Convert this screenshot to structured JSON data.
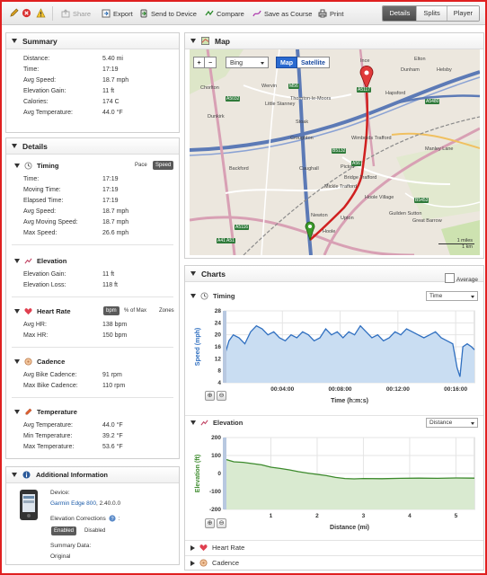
{
  "toolbar": {
    "share": "Share",
    "export": "Export",
    "send": "Send to Device",
    "compare": "Compare",
    "save_course": "Save as Course",
    "print": "Print",
    "views": [
      "Details",
      "Splits",
      "Player"
    ]
  },
  "summary": {
    "title": "Summary",
    "rows": [
      {
        "label": "Distance:",
        "value": "5.40 mi"
      },
      {
        "label": "Time:",
        "value": "17:19"
      },
      {
        "label": "Avg Speed:",
        "value": "18.7 mph"
      },
      {
        "label": "Elevation Gain:",
        "value": "11 ft"
      },
      {
        "label": "Calories:",
        "value": "174 C"
      },
      {
        "label": "Avg Temperature:",
        "value": "44.0 °F"
      }
    ]
  },
  "details": {
    "title": "Details",
    "timing": {
      "title": "Timing",
      "toggle": [
        "Pace",
        "Speed"
      ],
      "rows": [
        {
          "label": "Time:",
          "value": "17:19"
        },
        {
          "label": "Moving Time:",
          "value": "17:19"
        },
        {
          "label": "Elapsed Time:",
          "value": "17:19"
        },
        {
          "label": "Avg Speed:",
          "value": "18.7 mph"
        },
        {
          "label": "Avg Moving Speed:",
          "value": "18.7 mph"
        },
        {
          "label": "Max Speed:",
          "value": "26.6 mph"
        }
      ]
    },
    "elevation": {
      "title": "Elevation",
      "rows": [
        {
          "label": "Elevation Gain:",
          "value": "11 ft"
        },
        {
          "label": "Elevation Loss:",
          "value": "118 ft"
        }
      ]
    },
    "heart_rate": {
      "title": "Heart Rate",
      "toggle": [
        "bpm",
        "% of Max",
        "Zones"
      ],
      "rows": [
        {
          "label": "Avg HR:",
          "value": "138 bpm"
        },
        {
          "label": "Max HR:",
          "value": "150 bpm"
        }
      ]
    },
    "cadence": {
      "title": "Cadence",
      "rows": [
        {
          "label": "Avg Bike Cadence:",
          "value": "91 rpm"
        },
        {
          "label": "Max Bike Cadence:",
          "value": "110 rpm"
        }
      ]
    },
    "temperature": {
      "title": "Temperature",
      "rows": [
        {
          "label": "Avg Temperature:",
          "value": "44.0 °F"
        },
        {
          "label": "Min Temperature:",
          "value": "39.2 °F"
        },
        {
          "label": "Max Temperature:",
          "value": "53.6 °F"
        }
      ]
    }
  },
  "additional": {
    "title": "Additional Information",
    "device_label": "Device:",
    "device_name": "Garmin Edge 800",
    "device_version": ", 2.40.0.0",
    "elevation_corrections_label": "Elevation Corrections",
    "elevation_corrections_suffix": ":",
    "enabled": "Enabled",
    "disabled": "Disabled",
    "summary_data_label": "Summary Data:",
    "summary_data_value": "Original"
  },
  "map": {
    "title": "Map",
    "provider": "Bing",
    "map_btn": "Map",
    "satellite_btn": "Satellite",
    "scale_mi": "1 miles",
    "scale_km": "1 km",
    "places": [
      "Thornton-le-Moors",
      "Wervin",
      "Stoak",
      "Croughton",
      "Picton",
      "Bridge Trafford",
      "Mickle Trafford",
      "Hoole Village",
      "Guilden Sutton",
      "Upton",
      "Newton",
      "Hoole",
      "Great Barrow",
      "Wimbolds Trafford",
      "Hapsford",
      "Helsby",
      "Dunham",
      "Manley Lane",
      "Backford",
      "Caughall",
      "Ince",
      "Elton",
      "Chorlton",
      "Dunkirk",
      "Little Stanney"
    ],
    "roads": [
      "A5117",
      "A5032",
      "A5116",
      "A41",
      "M56",
      "A56",
      "B5132",
      "B5453",
      "A5480",
      "A51"
    ]
  },
  "charts": {
    "title": "Charts",
    "average_label": "Average",
    "timing": {
      "title": "Timing",
      "select": "Time"
    },
    "elevation": {
      "title": "Elevation",
      "select": "Distance"
    },
    "heart_rate": {
      "title": "Heart Rate"
    },
    "cadence": {
      "title": "Cadence"
    }
  },
  "chart_data": [
    {
      "type": "area",
      "ylabel": "Speed (mph)",
      "xlabel": "Time (h:m:s)",
      "x_tick_labels": [
        "00:04:00",
        "00:08:00",
        "00:12:00",
        "00:16:00"
      ],
      "x_ticks_min": [
        4,
        8,
        12,
        16
      ],
      "y_ticks": [
        4,
        8,
        12,
        16,
        20,
        24,
        28
      ],
      "ylim": [
        4,
        28
      ],
      "xlim_min": [
        0,
        17.3
      ],
      "x_min": [
        0,
        0.3,
        0.6,
        1.0,
        1.4,
        1.8,
        2.2,
        2.6,
        3.0,
        3.4,
        3.8,
        4.2,
        4.6,
        5.0,
        5.4,
        5.8,
        6.2,
        6.6,
        7.0,
        7.4,
        7.8,
        8.2,
        8.6,
        9.0,
        9.4,
        9.8,
        10.2,
        10.6,
        11.0,
        11.4,
        11.8,
        12.2,
        12.6,
        13.0,
        13.4,
        13.8,
        14.2,
        14.6,
        15.0,
        15.4,
        15.8,
        16.1,
        16.3,
        16.5,
        16.8,
        17.1,
        17.3
      ],
      "values": [
        13,
        18,
        20,
        19,
        17,
        21,
        23,
        22,
        20,
        21,
        19,
        18,
        20,
        19,
        21,
        20,
        18,
        19,
        22,
        20,
        21,
        19,
        21,
        20,
        23,
        21,
        19,
        20,
        18,
        19,
        21,
        20,
        22,
        21,
        20,
        19,
        20,
        21,
        19,
        18,
        17,
        9,
        6,
        16,
        17,
        16,
        15
      ]
    },
    {
      "type": "area",
      "ylabel": "Elevation (ft)",
      "xlabel": "Distance (mi)",
      "x_ticks": [
        1,
        2,
        3,
        4,
        5
      ],
      "y_ticks": [
        -200,
        -100,
        0,
        100,
        200
      ],
      "ylim": [
        -200,
        200
      ],
      "xlim": [
        0,
        5.4
      ],
      "x": [
        0,
        0.2,
        0.4,
        0.6,
        0.8,
        1.0,
        1.2,
        1.4,
        1.6,
        1.8,
        2.0,
        2.2,
        2.4,
        2.6,
        2.8,
        3.0,
        3.4,
        3.8,
        4.2,
        4.6,
        5.0,
        5.4
      ],
      "values": [
        80,
        65,
        62,
        55,
        48,
        35,
        28,
        20,
        10,
        2,
        -5,
        -12,
        -22,
        -28,
        -30,
        -28,
        -29,
        -27,
        -26,
        -27,
        -25,
        -26
      ]
    }
  ]
}
